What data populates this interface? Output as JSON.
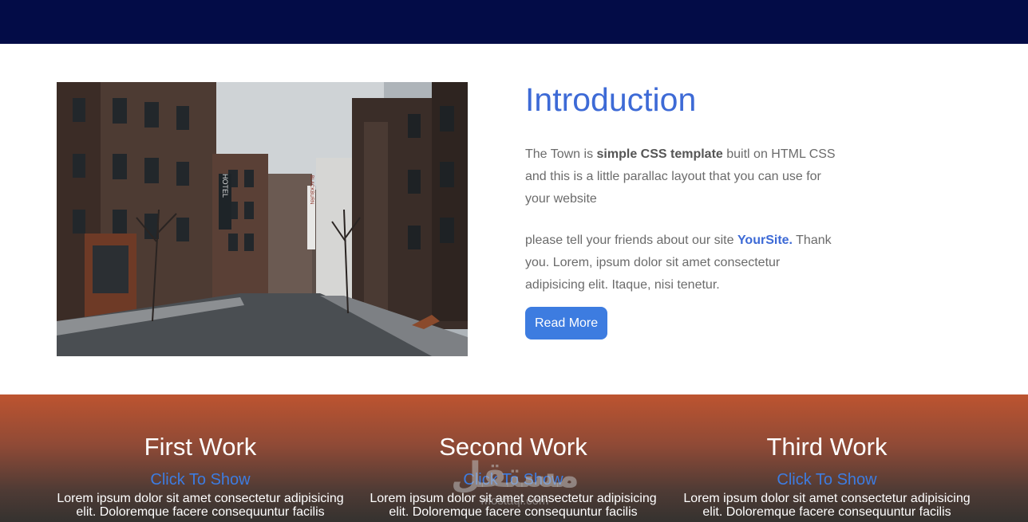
{
  "intro": {
    "image_alt": "town street",
    "sign_hotel": "HOTEL",
    "sign_blackburn": "BLACKBURN",
    "title": "Introduction",
    "p1_a": "The Town is ",
    "p1_bold": "simple CSS template",
    "p1_b": " buitl on HTML CSS and this is a little parallac layout that you can use for your website",
    "p2_a": "please tell your friends about our site ",
    "p2_site": "YourSite.",
    "p2_b": " Thank you. Lorem, ipsum dolor sit amet consectetur adipisicing elit. Itaque, nisi tenetur.",
    "button": "Read More",
    "colors": {
      "accent": "#3d6ad6",
      "button": "#3d7ce0"
    }
  },
  "works": [
    {
      "title": "First Work",
      "link": "Click To Show",
      "desc": "Lorem ipsum dolor sit amet consectetur adipisicing elit. Doloremque facere consequuntur facilis"
    },
    {
      "title": "Second Work",
      "link": "Click To Show",
      "desc": "Lorem ipsum dolor sit amet consectetur adipisicing elit. Doloremque facere consequuntur facilis"
    },
    {
      "title": "Third Work",
      "link": "Click To Show",
      "desc": "Lorem ipsum dolor sit amet consectetur adipisicing elit. Doloremque facere consequuntur facilis"
    }
  ],
  "watermark": {
    "arabic": "مستقل",
    "latin": "mostaql.com"
  },
  "colors": {
    "topbar": "#030c47",
    "works_top": "#bd5430",
    "works_bottom": "#35322f"
  }
}
